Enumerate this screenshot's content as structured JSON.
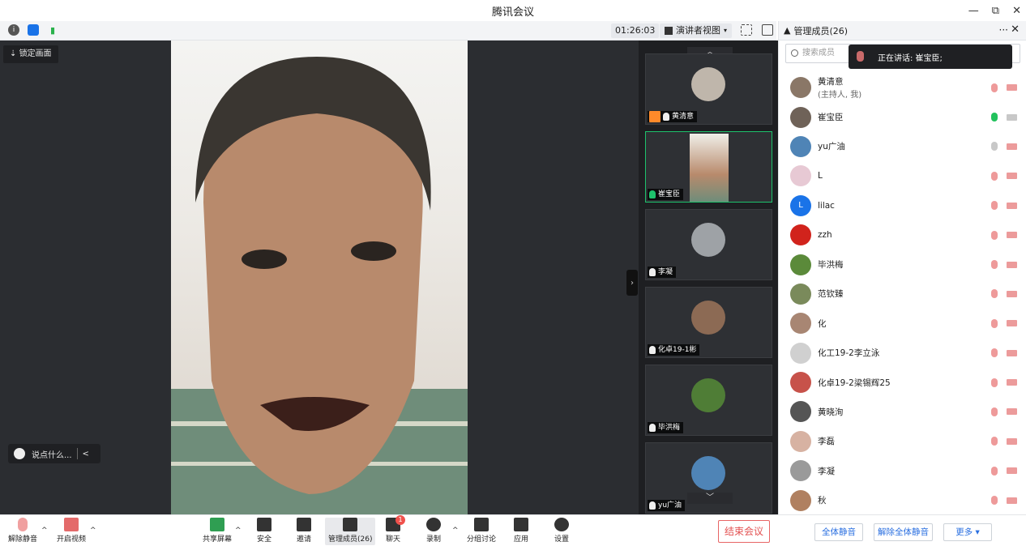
{
  "window": {
    "title": "腾讯会议",
    "minimize": "—",
    "restore": "⧉",
    "close": "✕"
  },
  "topbar": {
    "timer": "01:26:03",
    "view_mode": "演讲者视图",
    "icons": [
      "info-icon",
      "shield-icon",
      "signal-icon"
    ]
  },
  "stage": {
    "lock_label": "锁定画面",
    "chat_placeholder": "说点什么...",
    "chat_collapse": "<"
  },
  "gallery": {
    "tiles": [
      {
        "name": "黄清意",
        "host": true,
        "mic": "white"
      },
      {
        "name": "崔宝臣",
        "host": false,
        "mic": "green",
        "active": true
      },
      {
        "name": "李凝",
        "host": false,
        "mic": "white"
      },
      {
        "name": "化卓19-1彬",
        "host": false,
        "mic": "white"
      },
      {
        "name": "毕洪梅",
        "host": false,
        "mic": "white"
      },
      {
        "name": "yu广油",
        "host": false,
        "mic": "white"
      }
    ]
  },
  "panel": {
    "title": "管理成员(26)",
    "more": "···",
    "close": "✕",
    "search_placeholder": "搜索成员",
    "speaking": "正在讲话: 崔宝臣;",
    "members": [
      {
        "name": "黄清意",
        "sub": "(主持人, 我)",
        "avatar_color": "#8a7767",
        "mic": "muted",
        "cam": "off"
      },
      {
        "name": "崔宝臣",
        "sub": "",
        "avatar_color": "#6f6258",
        "mic": "live",
        "cam": "ok"
      },
      {
        "name": "yu广油",
        "sub": "",
        "avatar_color": "#4f84b6",
        "mic": "ok",
        "cam": "off"
      },
      {
        "name": "L",
        "sub": "",
        "avatar_color": "#e7c9d4",
        "mic": "muted",
        "cam": "off"
      },
      {
        "name": "lilac",
        "sub": "",
        "avatar_color": "#1a73e8",
        "avatar_letter": "L",
        "mic": "muted",
        "cam": "off"
      },
      {
        "name": "zzh",
        "sub": "",
        "avatar_color": "#d1231c",
        "mic": "muted",
        "cam": "off"
      },
      {
        "name": "毕洪梅",
        "sub": "",
        "avatar_color": "#5b8a3a",
        "mic": "muted",
        "cam": "off"
      },
      {
        "name": "范钦臻",
        "sub": "",
        "avatar_color": "#7a8a5b",
        "mic": "muted",
        "cam": "off"
      },
      {
        "name": "化",
        "sub": "",
        "avatar_color": "#a88673",
        "mic": "muted",
        "cam": "off"
      },
      {
        "name": "化工19-2李立泳",
        "sub": "",
        "avatar_color": "#d0d0d0",
        "mic": "muted",
        "cam": "off"
      },
      {
        "name": "化卓19-2梁锡辉25",
        "sub": "",
        "avatar_color": "#c7524a",
        "mic": "muted",
        "cam": "off"
      },
      {
        "name": "黄晓洵",
        "sub": "",
        "avatar_color": "#555555",
        "mic": "muted",
        "cam": "off"
      },
      {
        "name": "李磊",
        "sub": "",
        "avatar_color": "#d7b2a2",
        "mic": "muted",
        "cam": "off"
      },
      {
        "name": "李凝",
        "sub": "",
        "avatar_color": "#9a9a9a",
        "mic": "muted",
        "cam": "off"
      },
      {
        "name": "秋",
        "sub": "",
        "avatar_color": "#b08060",
        "mic": "muted",
        "cam": "off"
      }
    ],
    "mute_all": "全体静音",
    "unmute_all": "解除全体静音",
    "more_btn": "更多 ▾"
  },
  "toolbar": {
    "unmute": "解除静音",
    "start_video": "开启视频",
    "share_screen": "共享屏幕",
    "security": "安全",
    "invite": "邀请",
    "members": "管理成员(26)",
    "chat": "聊天",
    "chat_badge": "1",
    "record": "录制",
    "breakout": "分组讨论",
    "apps": "应用",
    "settings": "设置",
    "end_meeting": "结束会议"
  },
  "colors": {
    "accent": "#1ec26c",
    "danger": "#e35151",
    "link": "#2a6fe0"
  }
}
